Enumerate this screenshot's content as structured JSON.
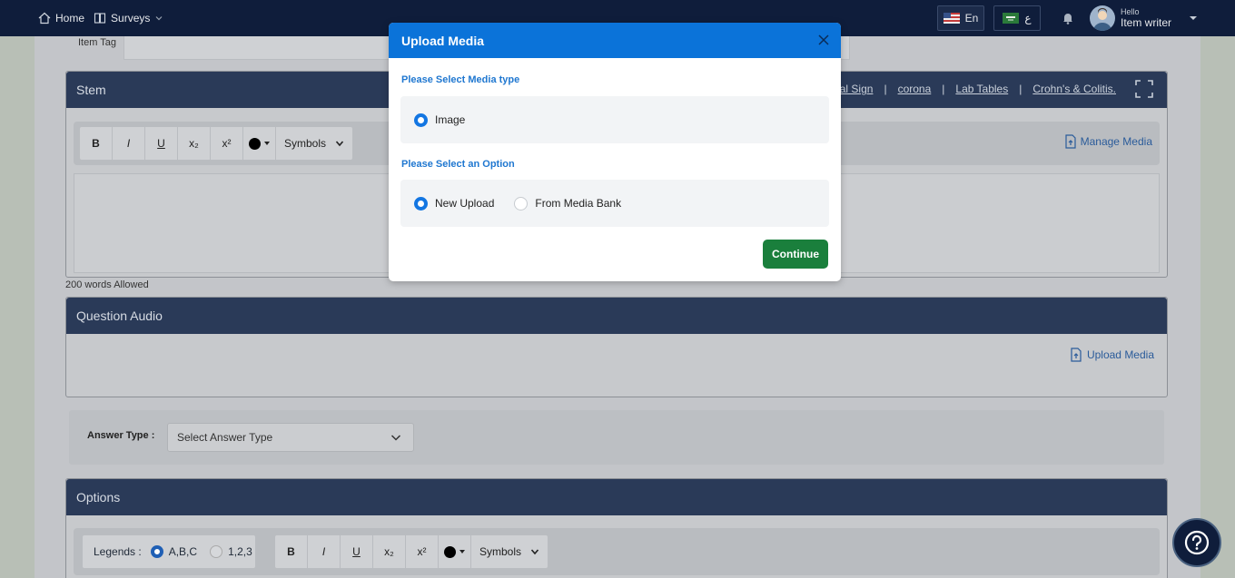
{
  "nav": {
    "home": "Home",
    "surveys": "Surveys",
    "lang_en": "En",
    "lang_ar": "ع",
    "hello": "Hello",
    "user_name": "Item writer"
  },
  "item_tag": {
    "label": "Item Tag"
  },
  "stem": {
    "title": "Stem",
    "links": [
      "Vital Sign",
      "corona",
      "Lab Tables",
      "Crohn's & Colitis."
    ],
    "separator": "|",
    "toolbar": {
      "bold": "B",
      "italic": "I",
      "underline": "U",
      "subscript": "x₂",
      "superscript": "x²",
      "symbols": "Symbols"
    },
    "manage_media": "Manage Media",
    "words_allowed": "200 words Allowed"
  },
  "audio": {
    "title": "Question Audio",
    "upload_media": "Upload Media"
  },
  "answer_type": {
    "label": "Answer Type :",
    "placeholder": "Select Answer Type"
  },
  "options": {
    "title": "Options",
    "legends_label": "Legends :",
    "legend_abc": "A,B,C",
    "legend_123": "1,2,3",
    "toolbar": {
      "bold": "B",
      "italic": "I",
      "underline": "U",
      "subscript": "x₂",
      "superscript": "x²",
      "symbols": "Symbols"
    }
  },
  "modal": {
    "title": "Upload Media",
    "media_type_label": "Please Select Media type",
    "media_type_option": "Image",
    "option_label": "Please Select an Option",
    "option_new": "New Upload",
    "option_bank": "From Media Bank",
    "continue": "Continue"
  },
  "colors": {
    "nav_bg": "#0f1d3b",
    "modal_header": "#0b73d9",
    "continue_btn": "#1a7f3c",
    "accent_blue": "#1376e2"
  }
}
